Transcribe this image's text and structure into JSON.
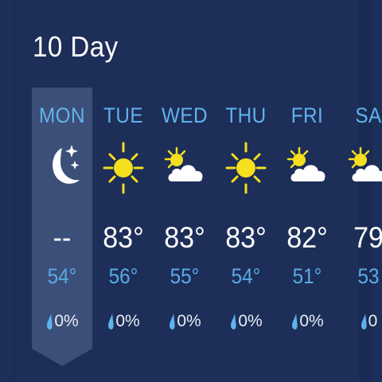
{
  "header": {
    "title": "10 Day"
  },
  "days": [
    {
      "dow": "MON",
      "icon": "moon-stars-icon",
      "hi": "--",
      "lo": "54°",
      "precip": "0%",
      "selected": true
    },
    {
      "dow": "TUE",
      "icon": "sun-icon",
      "hi": "83°",
      "lo": "56°",
      "precip": "0%"
    },
    {
      "dow": "WED",
      "icon": "partly-cloudy-icon",
      "hi": "83°",
      "lo": "55°",
      "precip": "0%"
    },
    {
      "dow": "THU",
      "icon": "sun-icon",
      "hi": "83°",
      "lo": "54°",
      "precip": "0%"
    },
    {
      "dow": "FRI",
      "icon": "partly-cloudy-icon",
      "hi": "82°",
      "lo": "51°",
      "precip": "0%"
    },
    {
      "dow": "SA",
      "icon": "partly-cloudy-icon",
      "hi": "79",
      "lo": "53",
      "precip": "0"
    }
  ],
  "colors": {
    "background": "#1c2f59",
    "accent_blue": "#5fb3ef",
    "low_temp": "#5aaae6",
    "sun_yellow": "#f5df1e",
    "selected_column": "#3c4f79"
  }
}
